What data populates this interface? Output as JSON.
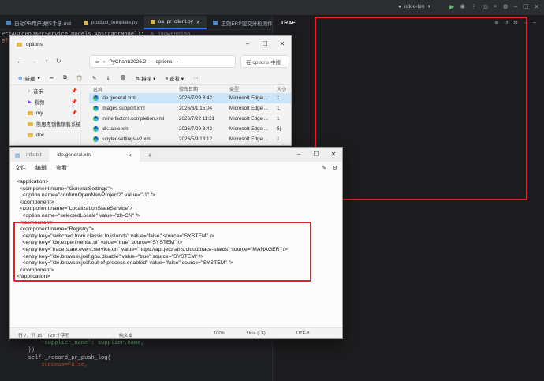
{
  "ide": {
    "tabs": [
      {
        "label": "自动PR用户操作手册.md",
        "icon_color": "#4a86c8"
      },
      {
        "label": "product_template.py",
        "icon_color": "#d6b656"
      },
      {
        "label": "oa_pr_client.py",
        "icon_color": "#d6b656",
        "active": true
      },
      {
        "label": "正则ERP提交分检测作说明.md",
        "icon_color": "#4a86c8"
      }
    ],
    "code_top": [
      "PrjAutoPoDaPrService(models.AbstractModel):  ",
      "ef pu"
    ],
    "code_top_author": "& baowenqiao",
    "code_bottom": [
      "            'supplier_name': supplier.name,",
      "        })",
      "        self._record_pr_push_log(",
      "            success=False,"
    ],
    "run_config": "odoo-bm",
    "trae_title": "TRAE"
  },
  "explorer": {
    "title": "options",
    "breadcrumb": [
      "PyCharm2026.2",
      "options"
    ],
    "search_placeholder": "在 options 中搜",
    "toolbar": {
      "new_label": "新建",
      "sort_label": "排序",
      "view_label": "查看"
    },
    "sidebar": [
      {
        "label": "音乐",
        "icon": "music-icon",
        "color": "#e04a4a"
      },
      {
        "label": "视频",
        "icon": "video-icon",
        "color": "#7b4ae0"
      },
      {
        "label": "my",
        "icon": "folder-icon",
        "color": "#e8b84a"
      },
      {
        "label": "熊思杰销售销售系统",
        "icon": "folder-icon",
        "color": "#e8b84a"
      },
      {
        "label": "doc",
        "icon": "folder-icon",
        "color": "#e8b84a"
      }
    ],
    "columns": {
      "name": "名称",
      "date": "修改日期",
      "type": "类型",
      "size": "大小"
    },
    "files": [
      {
        "name": "ide.general.xml",
        "date": "2026/7/29 8:42",
        "type": "Microsoft Edge ...",
        "size": "1",
        "selected": true
      },
      {
        "name": "images.support.xml",
        "date": "2026/6/1 15:04",
        "type": "Microsoft Edge ...",
        "size": "1"
      },
      {
        "name": "inline.factors.completion.xml",
        "date": "2026/7/22 11:31",
        "type": "Microsoft Edge ...",
        "size": "1"
      },
      {
        "name": "jdk.table.xml",
        "date": "2026/7/29 8:42",
        "type": "Microsoft Edge ...",
        "size": "5("
      },
      {
        "name": "jupyter-settings-v2.xml",
        "date": "2026/5/9 13:12",
        "type": "Microsoft Edge ...",
        "size": "1"
      }
    ]
  },
  "notepad": {
    "tabs": [
      "info.txt",
      "ide.general.xml"
    ],
    "menu": [
      "文件",
      "编辑",
      "查看"
    ],
    "lines": [
      "<application>",
      "  <component name=\"GeneralSettings\">",
      "    <option name=\"confirmOpenNewProject2\" value=\"-1\" />",
      "  </component>",
      "  <component name=\"LocalizationStateService\">",
      "    <option name=\"selectedLocale\" value=\"zh-CN\" />",
      "  </component>",
      "  <component name=\"Registry\">",
      "    <entry key=\"switched.from.classic.to.islands\" value=\"false\" source=\"SYSTEM\" />",
      "    <entry key=\"ide.experimental.ui\" value=\"true\" source=\"SYSTEM\" />",
      "    <entry key=\"trace.state.event.service.url\" value=\"https://api.jetbrains.cloud/trace-status\" source=\"MANAGER\" />",
      "    <entry key=\"ide.browser.jcef.gpu.disable\" value=\"true\" source=\"SYSTEM\" />",
      "    <entry key=\"ide.browser.jcef.out-of-process.enabled\" value=\"false\" source=\"SYSTEM\" />",
      "  </component>",
      "</application>"
    ],
    "status": {
      "position": "行 7，列 15",
      "chars": "729 个字符",
      "format": "纯文本",
      "zoom": "100%",
      "eol": "Unix (LF)",
      "encoding": "UTF-8"
    }
  },
  "colors": {
    "highlight": "#e0232e",
    "ide_bg": "#1e1f22",
    "selection": "#cce4f7"
  }
}
